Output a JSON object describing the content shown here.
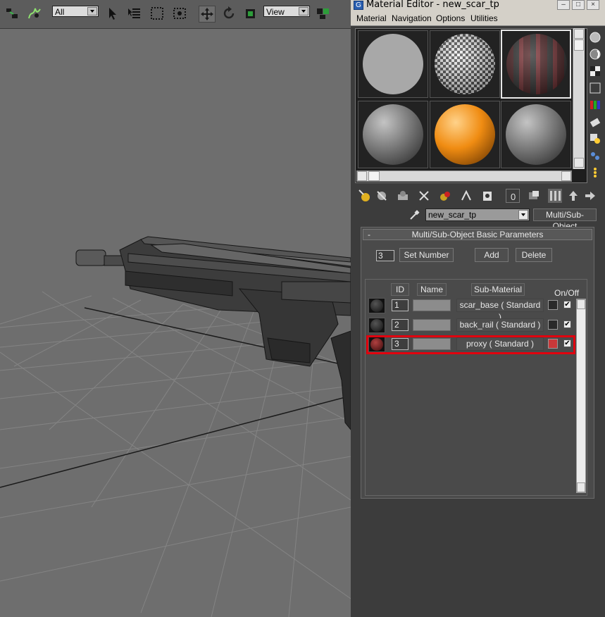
{
  "max_toolbar": {
    "selection_filter": "All",
    "ref_coord": "View",
    "icons": [
      "select-link-icon",
      "bind-spacewarp-icon",
      "select-object-icon",
      "select-by-name-icon",
      "rect-region-icon",
      "window-crossing-icon",
      "move-icon",
      "rotate-icon",
      "scale-icon",
      "pivot-icon"
    ]
  },
  "material_editor": {
    "title": "Material Editor - new_scar_tp",
    "menu": [
      "Material",
      "Navigation",
      "Options",
      "Utilities"
    ],
    "sample_slots": [
      {
        "kind": "flat-gray"
      },
      {
        "kind": "checker"
      },
      {
        "kind": "red-texture",
        "active": true
      },
      {
        "kind": "gray"
      },
      {
        "kind": "orange"
      },
      {
        "kind": "gray"
      }
    ],
    "material_name": "new_scar_tp",
    "material_type": "Multi/Sub-Object",
    "rollout": {
      "title": "Multi/Sub-Object Basic Parameters",
      "collapse_symbol": "-",
      "set_number_value": "3",
      "set_number_label": "Set Number",
      "add_label": "Add",
      "delete_label": "Delete",
      "columns": {
        "id": "ID",
        "name": "Name",
        "submaterial": "Sub-Material",
        "onoff": "On/Off"
      },
      "rows": [
        {
          "id": "1",
          "name": "",
          "submaterial": "scar_base  ( Standard )",
          "color": "#2a2a2a",
          "on": true
        },
        {
          "id": "2",
          "name": "",
          "submaterial": "back_rail  ( Standard )",
          "color": "#2a2a2a",
          "on": true
        },
        {
          "id": "3",
          "name": "",
          "submaterial": "proxy  ( Standard )",
          "color": "#c8393a",
          "on": true,
          "highlighted": true
        }
      ]
    }
  },
  "colors": {
    "highlight": "#e1000e",
    "orange_sphere": "#f08c12",
    "viewport_bg": "#6e6e6e"
  }
}
